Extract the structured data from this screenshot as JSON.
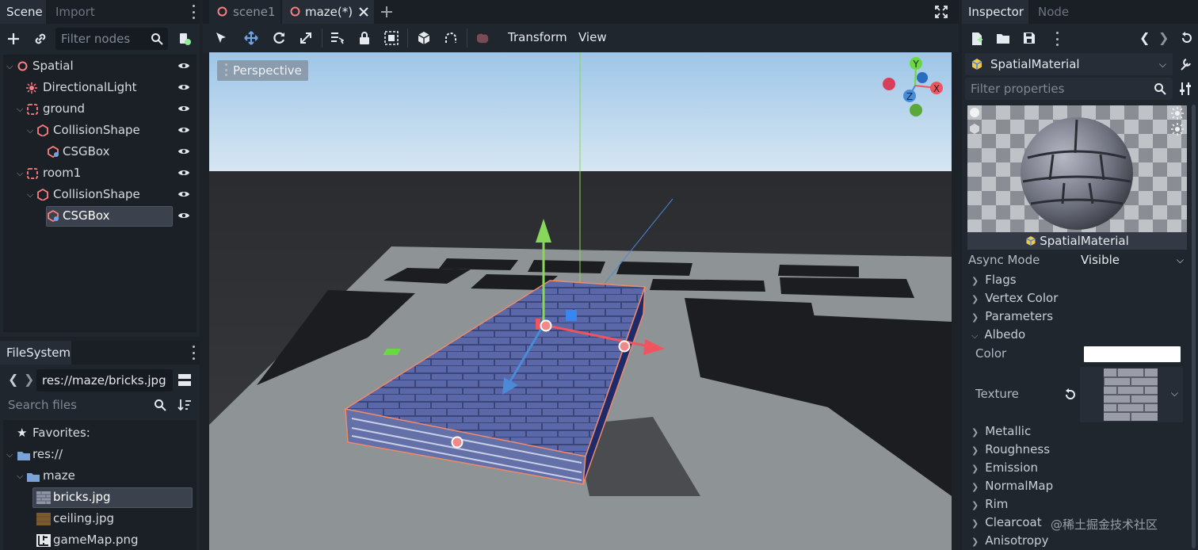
{
  "scene_dock": {
    "tabs": [
      "Scene",
      "Import"
    ],
    "filter_placeholder": "Filter nodes",
    "nodes": [
      {
        "label": "Spatial"
      },
      {
        "label": "DirectionalLight"
      },
      {
        "label": "ground"
      },
      {
        "label": "CollisionShape"
      },
      {
        "label": "CSGBox"
      },
      {
        "label": "room1"
      },
      {
        "label": "CollisionShape"
      },
      {
        "label": "CSGBox"
      }
    ]
  },
  "filesystem": {
    "tab": "FileSystem",
    "path": "res://maze/bricks.jpg",
    "search_placeholder": "Search files",
    "items": [
      {
        "label": "Favorites:"
      },
      {
        "label": "res://"
      },
      {
        "label": "maze"
      },
      {
        "label": "bricks.jpg"
      },
      {
        "label": "ceiling.jpg"
      },
      {
        "label": "gameMap.png"
      }
    ]
  },
  "editor_tabs": [
    "scene1",
    "maze(*)"
  ],
  "toolbar": {
    "transform": "Transform",
    "view": "View"
  },
  "viewport": {
    "mode": "Perspective",
    "gizmo_axes": [
      "Y",
      "Z",
      "X"
    ]
  },
  "inspector": {
    "tabs": [
      "Inspector",
      "Node"
    ],
    "resource_type": "SpatialMaterial",
    "filter_placeholder": "Filter properties",
    "preview_label": "SpatialMaterial",
    "async_mode_label": "Async Mode",
    "async_mode_value": "Visible",
    "sections_top": [
      "Flags",
      "Vertex Color",
      "Parameters",
      "Albedo"
    ],
    "color_label": "Color",
    "color_value": "#ffffff",
    "texture_label": "Texture",
    "sections_bottom": [
      "Metallic",
      "Roughness",
      "Emission",
      "NormalMap",
      "Rim",
      "Clearcoat",
      "Anisotropy"
    ]
  },
  "watermark": "@稀土掘金技术社区",
  "colors": {
    "accent": "#6ea4e8",
    "panel": "#20262e",
    "node_red": "#fc7f7f"
  }
}
